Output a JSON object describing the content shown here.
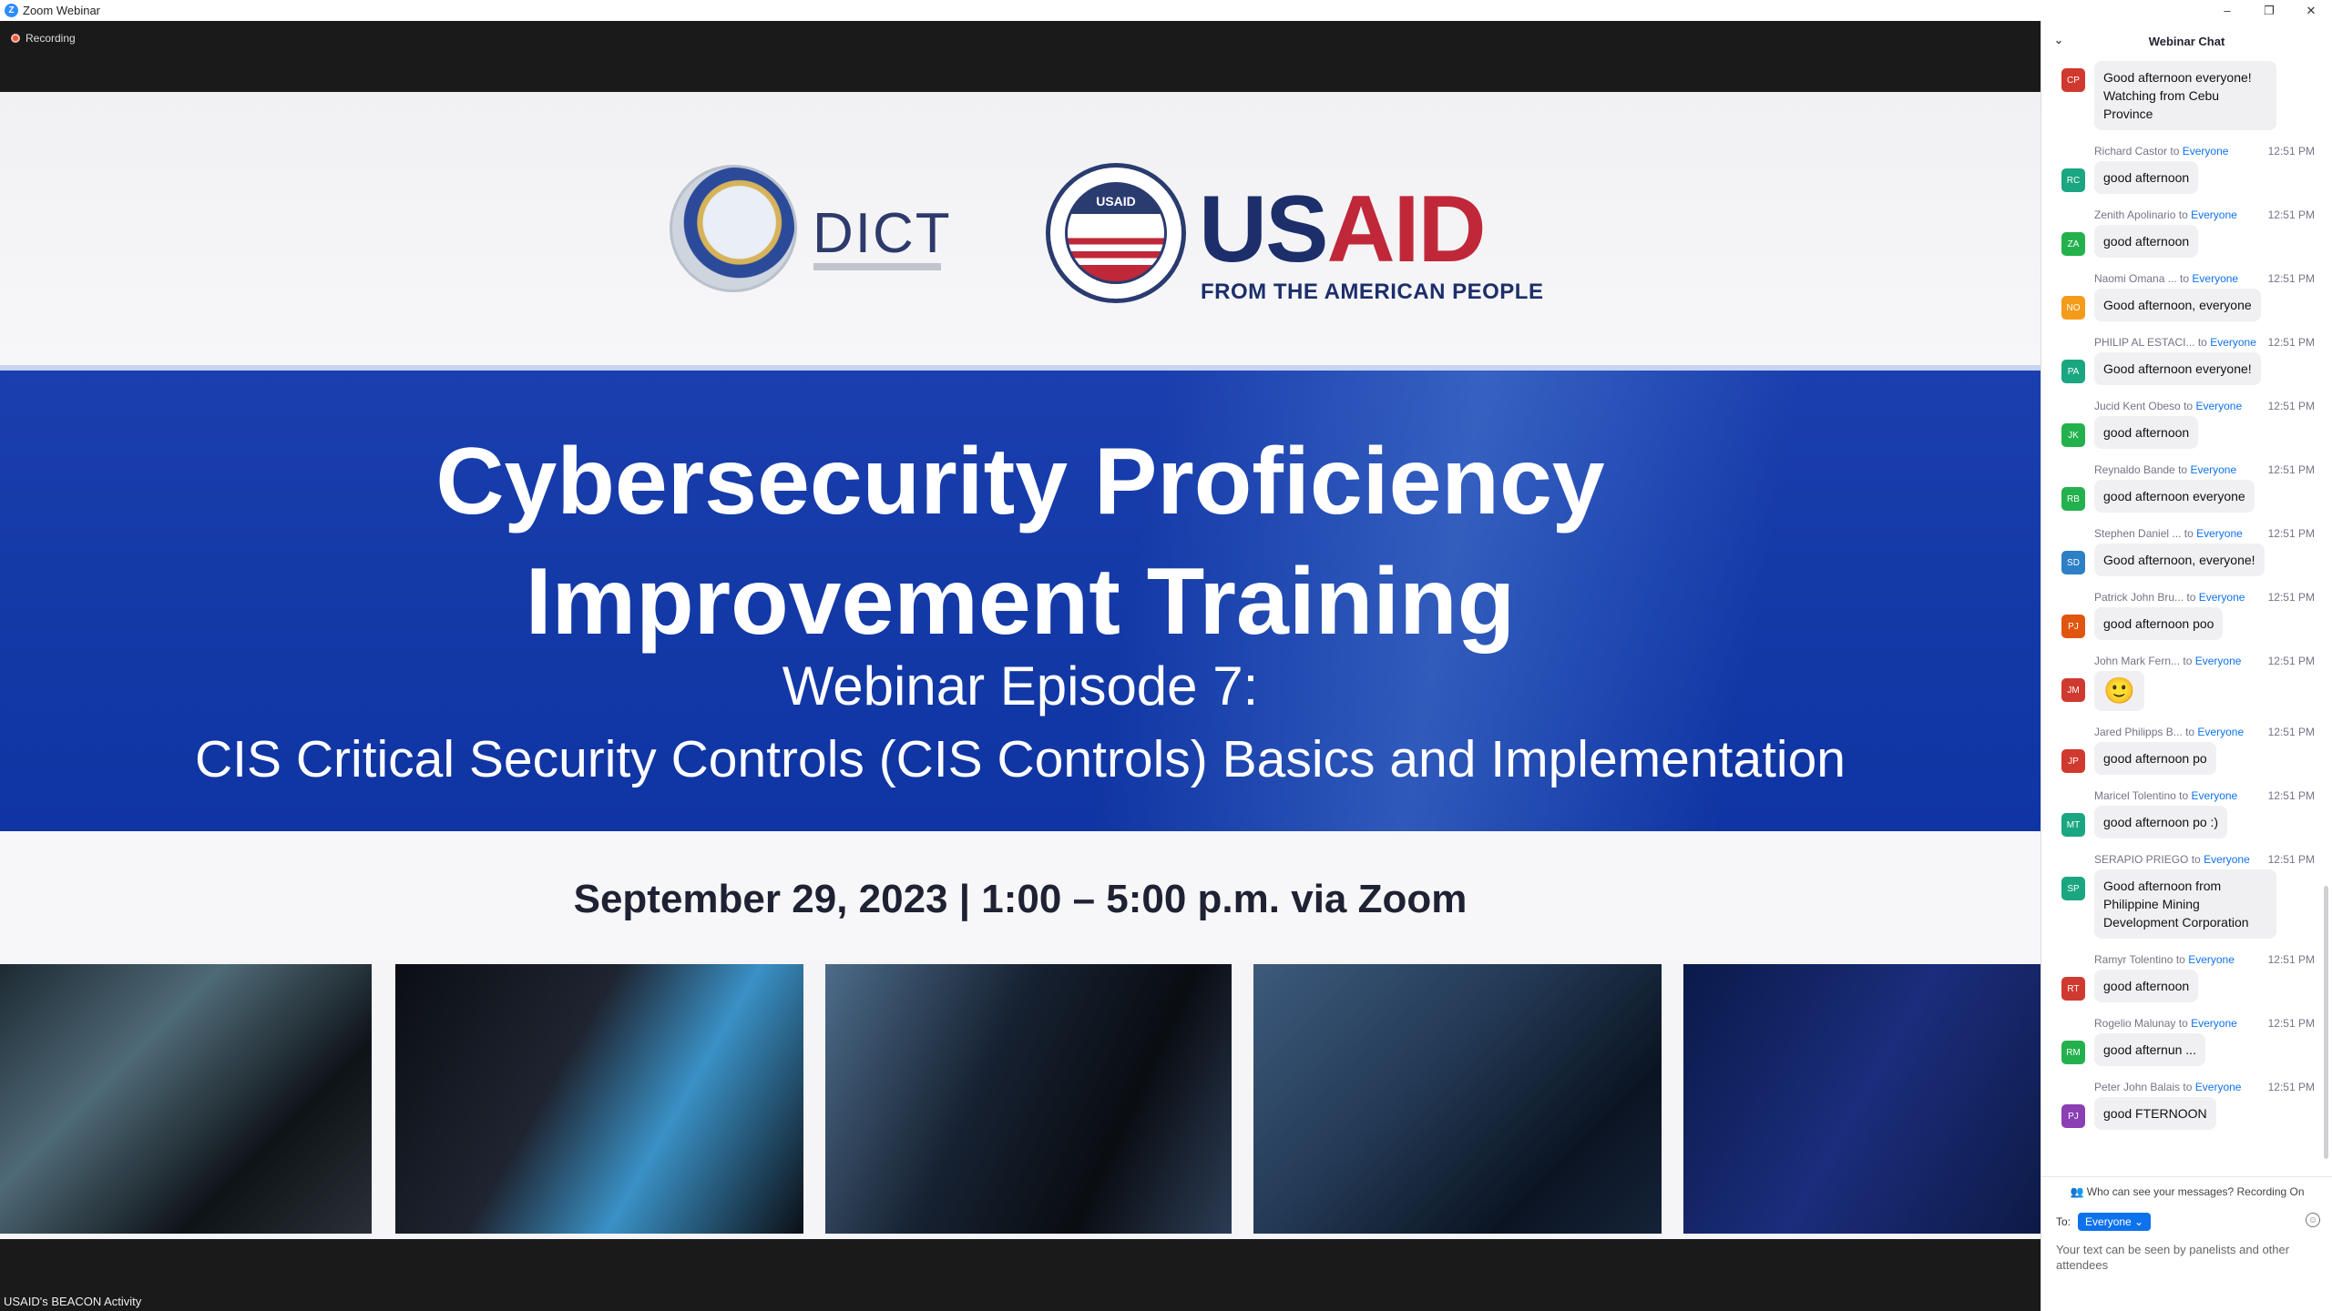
{
  "window": {
    "title": "Zoom Webinar",
    "app_logo_letter": "Z",
    "minimize": "–",
    "restore": "❐",
    "close": "✕"
  },
  "video": {
    "recording_label": "Recording",
    "presenter_name": "USAID's BEACON Activity",
    "slide": {
      "dict_logo_text": "DICT",
      "usaid_seal_text": "USAID",
      "usaid_us": "US",
      "usaid_aid": "AID",
      "usaid_tagline": "FROM THE AMERICAN PEOPLE",
      "title_line1": "Cybersecurity Proficiency",
      "title_line2": "Improvement Training",
      "episode": "Webinar Episode 7:",
      "subtitle": "CIS Critical Security Controls (CIS Controls) Basics and Implementation",
      "date": "September 29, 2023 | 1:00 – 5:00 p.m. via Zoom"
    }
  },
  "chat": {
    "title": "Webinar Chat",
    "collapse_icon": "⌄",
    "messages": [
      {
        "sender": "",
        "to": "",
        "time": "",
        "initials": "CP",
        "color": "#d0392f",
        "text": "Good afternoon everyone! Watching from Cebu Province"
      },
      {
        "sender": "Richard Castor",
        "to": "Everyone",
        "time": "12:51 PM",
        "initials": "RC",
        "color": "#1aa680",
        "text": "good afternoon"
      },
      {
        "sender": "Zenith Apolinario",
        "to": "Everyone",
        "time": "12:51 PM",
        "initials": "ZA",
        "color": "#23b14d",
        "text": "good afternoon"
      },
      {
        "sender": "Naomi Omana ...",
        "to": "Everyone",
        "time": "12:51 PM",
        "initials": "NO",
        "color": "#f49b1a",
        "text": "Good afternoon, everyone"
      },
      {
        "sender": "PHILIP AL ESTACI...",
        "to": "Everyone",
        "time": "12:51 PM",
        "initials": "PA",
        "color": "#1aa680",
        "text": "Good afternoon everyone!"
      },
      {
        "sender": "Jucid Kent Obeso",
        "to": "Everyone",
        "time": "12:51 PM",
        "initials": "JK",
        "color": "#23b14d",
        "text": "good afternoon"
      },
      {
        "sender": "Reynaldo Bande",
        "to": "Everyone",
        "time": "12:51 PM",
        "initials": "RB",
        "color": "#23b14d",
        "text": "good afternoon everyone"
      },
      {
        "sender": "Stephen Daniel ...",
        "to": "Everyone",
        "time": "12:51 PM",
        "initials": "SD",
        "color": "#2d7fc6",
        "text": "Good afternoon, everyone!"
      },
      {
        "sender": "Patrick John Bru...",
        "to": "Everyone",
        "time": "12:51 PM",
        "initials": "PJ",
        "color": "#e0550f",
        "text": "good afternoon poo"
      },
      {
        "sender": "John Mark Fern...",
        "to": "Everyone",
        "time": "12:51 PM",
        "initials": "JM",
        "color": "#d0392f",
        "text": "🙂"
      },
      {
        "sender": "Jared Philipps B...",
        "to": "Everyone",
        "time": "12:51 PM",
        "initials": "JP",
        "color": "#d0392f",
        "text": "good afternoon po"
      },
      {
        "sender": "Maricel Tolentino",
        "to": "Everyone",
        "time": "12:51 PM",
        "initials": "MT",
        "color": "#1aa680",
        "text": "good afternoon po :)"
      },
      {
        "sender": "SERAPIO PRIEGO",
        "to": "Everyone",
        "time": "12:51 PM",
        "initials": "SP",
        "color": "#1aa680",
        "text": "Good afternoon from Philippine Mining Development Corporation"
      },
      {
        "sender": "Ramyr Tolentino",
        "to": "Everyone",
        "time": "12:51 PM",
        "initials": "RT",
        "color": "#d0392f",
        "text": "good afternoon"
      },
      {
        "sender": "Rogelio Malunay",
        "to": "Everyone",
        "time": "12:51 PM",
        "initials": "RM",
        "color": "#23b14d",
        "text": "good afternun ..."
      },
      {
        "sender": "Peter John Balais",
        "to": "Everyone",
        "time": "12:51 PM",
        "initials": "PJ",
        "color": "#8a3fb4",
        "text": "good FTERNOON"
      }
    ],
    "connector": "to",
    "who_sees": "Who can see your messages? Recording On",
    "to_label": "To:",
    "to_value": "Everyone ⌄",
    "compose_hint": "Your text can be seen by panelists and other attendees",
    "emoji_icon": "☺"
  }
}
